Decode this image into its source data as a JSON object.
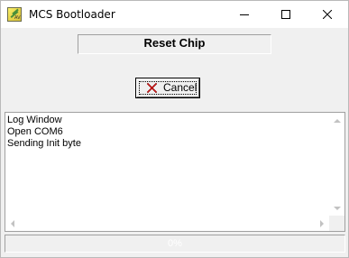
{
  "window": {
    "title": "MCS Bootloader",
    "icon": "mcs-bootloader-app-icon"
  },
  "titlebar_buttons": [
    {
      "name": "minimize",
      "icon": "minimize-icon"
    },
    {
      "name": "maximize",
      "icon": "maximize-icon"
    },
    {
      "name": "close",
      "icon": "close-icon"
    }
  ],
  "operation_label": "Reset Chip",
  "cancel_button": {
    "label": "Cancel",
    "icon": "red-x-icon",
    "icon_color": "#d11a1a"
  },
  "log": {
    "lines": [
      "Log Window",
      "Open COM6",
      "Sending Init byte"
    ]
  },
  "progress": {
    "text": "0%",
    "value": 0
  }
}
